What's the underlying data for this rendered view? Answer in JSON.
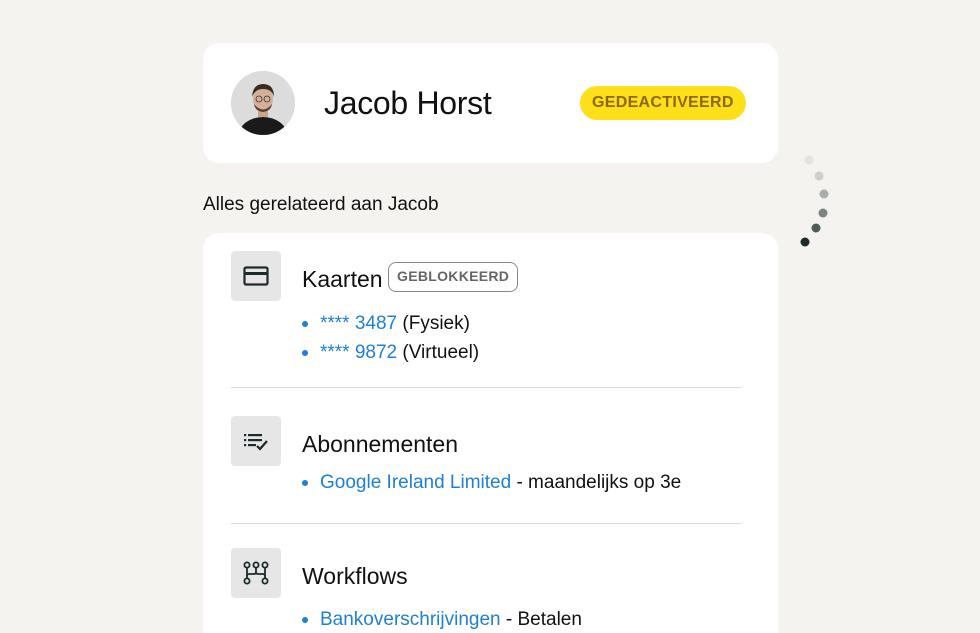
{
  "profile": {
    "name": "Jacob Horst",
    "status": "GEDEACTIVEERD"
  },
  "section_heading": "Alles gerelateerd aan Jacob",
  "cards": {
    "title": "Kaarten",
    "badge": "GEBLOKKEERD",
    "icon": "credit-card-icon",
    "items": [
      {
        "link": "**** 3487",
        "suffix": " (Fysiek)"
      },
      {
        "link": "**** 9872",
        "suffix": " (Virtueel)"
      }
    ]
  },
  "subscriptions": {
    "title": "Abonnementen",
    "icon": "checklist-icon",
    "items": [
      {
        "link": "Google Ireland Limited",
        "suffix": " - maandelijks op 3e"
      }
    ]
  },
  "workflows": {
    "title": "Workflows",
    "icon": "workflow-icon",
    "items": [
      {
        "link": "Bankoverschrijvingen",
        "suffix": " - Betalen"
      }
    ]
  },
  "colors": {
    "background": "#f4f3f0",
    "accent_link": "#1f7fd6",
    "status_yellow": "#ffde1a"
  }
}
